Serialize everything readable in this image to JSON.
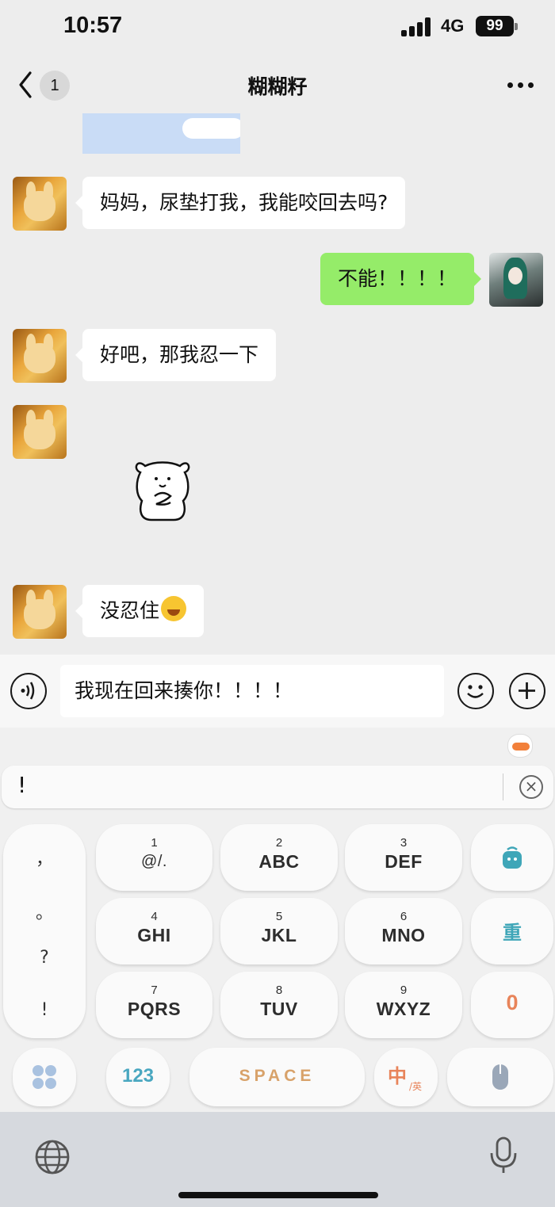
{
  "status_bar": {
    "time": "10:57",
    "network": "4G",
    "battery": "99"
  },
  "nav": {
    "unread_count": "1",
    "title": "糊糊籽"
  },
  "messages": [
    {
      "side": "left",
      "text": "妈妈，尿垫打我，我能咬回去吗?"
    },
    {
      "side": "right",
      "text": "不能！！！！"
    },
    {
      "side": "left",
      "text": "好吧，那我忍一下"
    },
    {
      "side": "left",
      "type": "sticker"
    },
    {
      "side": "left",
      "text": "没忍住"
    }
  ],
  "input": {
    "value": "我现在回来揍你！！！！"
  },
  "keyboard": {
    "candidate": "!",
    "punctuation": [
      "，",
      "。",
      "?",
      "!"
    ],
    "keys": [
      {
        "num": "1",
        "letters": "@/."
      },
      {
        "num": "2",
        "letters": "ABC"
      },
      {
        "num": "3",
        "letters": "DEF"
      },
      {
        "num": "4",
        "letters": "GHI"
      },
      {
        "num": "5",
        "letters": "JKL"
      },
      {
        "num": "6",
        "letters": "MNO"
      },
      {
        "num": "7",
        "letters": "PQRS"
      },
      {
        "num": "8",
        "letters": "TUV"
      },
      {
        "num": "9",
        "letters": "WXYZ"
      }
    ],
    "reset_label": "重",
    "zero_label": "0",
    "numeric_label": "123",
    "space_label": "SPACE",
    "lang_main": "中",
    "lang_sub": "/英"
  },
  "colors": {
    "sent_bubble": "#95ec69",
    "received_bubble": "#ffffff",
    "background": "#ededed",
    "zero_key": "#e8845a",
    "trash_key": "#3fa6b8"
  },
  "icons": [
    "back-chevron-icon",
    "more-icon",
    "voice-icon",
    "emoji-icon",
    "plus-icon",
    "clear-icon",
    "trash-icon",
    "apps-icon",
    "mouse-icon",
    "globe-icon",
    "mic-icon"
  ]
}
